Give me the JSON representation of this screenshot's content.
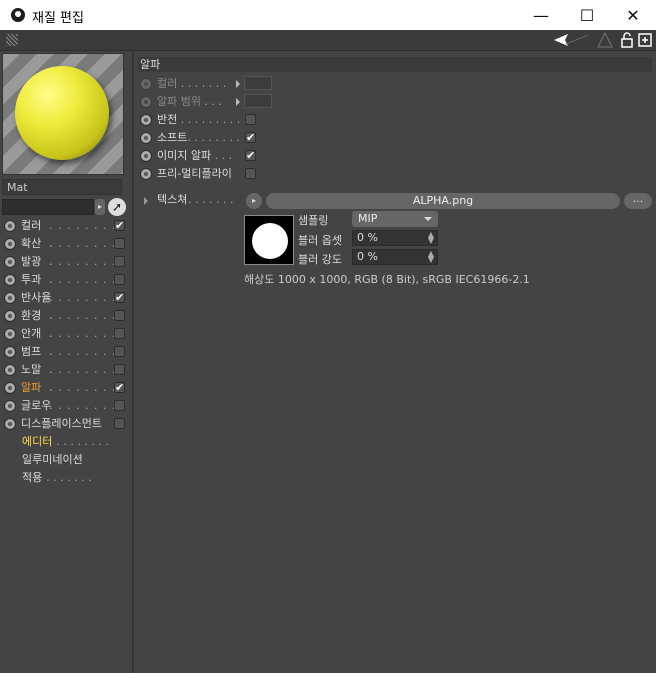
{
  "window": {
    "title": "재질 편집",
    "minimize": "—",
    "maximize": "☐",
    "close": "✕"
  },
  "material": {
    "name": "Mat"
  },
  "channels": [
    {
      "label": "컬러",
      "checked": true
    },
    {
      "label": "확산",
      "checked": false
    },
    {
      "label": "발광",
      "checked": false
    },
    {
      "label": "투과",
      "checked": false
    },
    {
      "label": "반사율",
      "checked": true
    },
    {
      "label": "환경",
      "checked": false
    },
    {
      "label": "안개",
      "checked": false
    },
    {
      "label": "범프",
      "checked": false
    },
    {
      "label": "노말",
      "checked": false
    },
    {
      "label": "알파",
      "checked": true,
      "selected": true
    },
    {
      "label": "글로우",
      "checked": false
    },
    {
      "label": "디스플레이스먼트",
      "checked": false
    }
  ],
  "extra_items": [
    {
      "label": "에디터"
    },
    {
      "label": "일루미네이션"
    },
    {
      "label": "적용"
    }
  ],
  "alpha_panel": {
    "title": "알파",
    "props": [
      {
        "label": "컬러",
        "dots": " . . . . . . .",
        "disabled": true
      },
      {
        "label": "알파 범위",
        "dots": " . . .",
        "disabled": true
      },
      {
        "label": "반전",
        "dots": " . . . . . . . . . .",
        "checked": false
      },
      {
        "label": "소프트",
        "dots": ". . . . . . . .",
        "checked": true
      },
      {
        "label": "이미지 알파",
        "dots": " . . .",
        "checked": true
      },
      {
        "label": "프리-멀티플라이",
        "dots": "",
        "checked": false
      }
    ],
    "texture_label": "텍스쳐",
    "texture_dots": " . . . . . . . .",
    "texture_file": "ALPHA.png",
    "texture_more": "...",
    "sampling_label": "샘플링",
    "sampling_value": "MIP",
    "blur_offset_label": "블러 옵셋",
    "blur_offset_value": "0 %",
    "blur_strength_label": "블러 강도",
    "blur_strength_value": "0 %",
    "resolution_info": "해상도 1000 x 1000, RGB (8 Bit), sRGB IEC61966-2.1"
  },
  "dots_channel": " . . . . . . . . . ."
}
